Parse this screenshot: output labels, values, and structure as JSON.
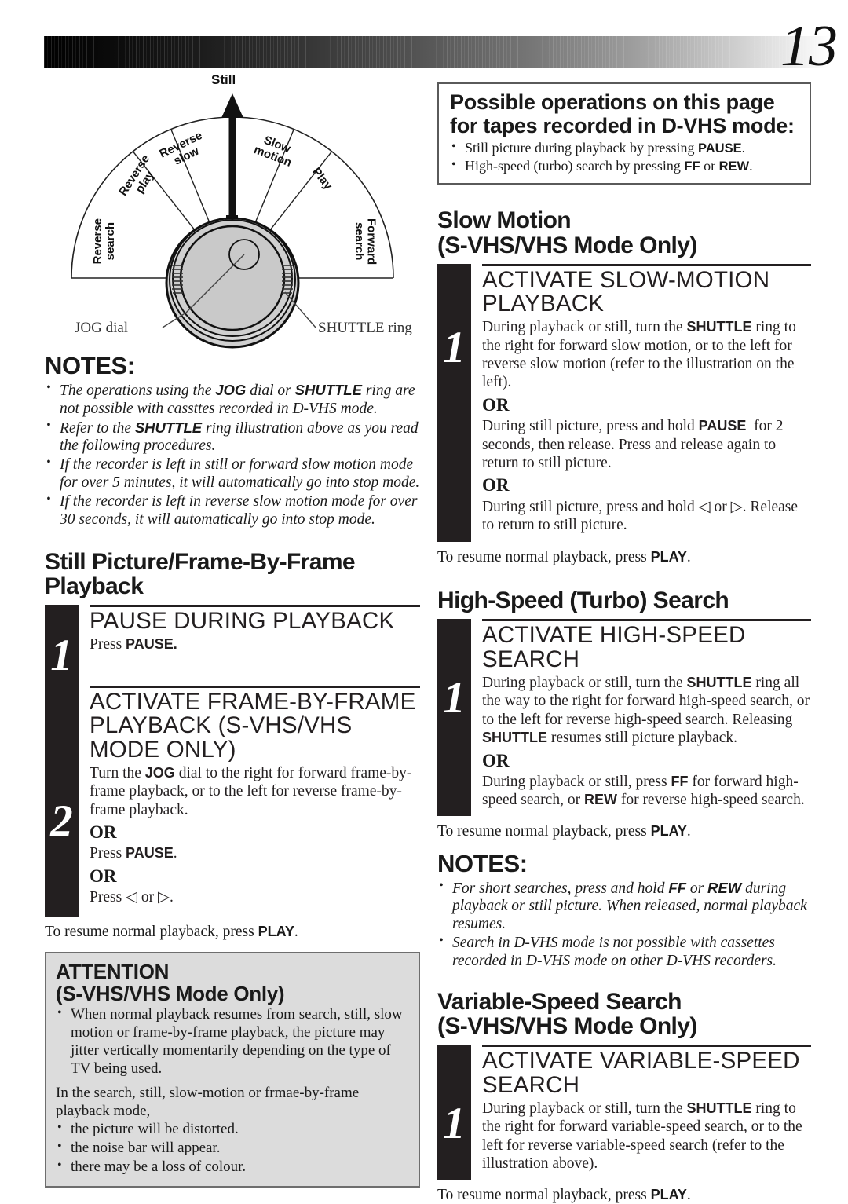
{
  "page": {
    "number": "13"
  },
  "diagram": {
    "title": "Still",
    "sectors": [
      "Reverse search",
      "Reverse play",
      "Reverse slow",
      "Slow motion",
      "Play",
      "Forward search"
    ],
    "callouts": {
      "jog": "JOG dial",
      "shuttle": "SHUTTLE ring"
    }
  },
  "notes_left": {
    "heading": "NOTES:",
    "items": [
      "The operations using the JOG dial or SHUTTLE ring are not possible with cassttes recorded in D-VHS mode.",
      "Refer to the SHUTTLE ring illustration above as you read the following procedures.",
      "If the recorder is left in still or forward slow motion mode for over 5 minutes, it will automatically go into stop mode.",
      "If the recorder is left in reverse slow motion mode for over 30 seconds, it will automatically go into stop mode."
    ]
  },
  "still_picture": {
    "heading": "Still Picture/Frame-By-Frame Playback",
    "step1": {
      "num": "1",
      "title": "PAUSE DURING PLAYBACK",
      "body": "Press PAUSE."
    },
    "step2": {
      "num": "2",
      "title": "ACTIVATE FRAME-BY-FRAME PLAYBACK (S-VHS/VHS MODE ONLY)",
      "body": "Turn the JOG dial to the right for forward frame-by-frame playback, or to the left for reverse frame-by-frame playback.",
      "or1_label": "OR",
      "or1_body": "Press PAUSE.",
      "or2_label": "OR",
      "or2_body": "Press ◁ or ▷."
    },
    "resume": "To resume normal playback, press PLAY."
  },
  "attention": {
    "heading_line1": "ATTENTION",
    "heading_line2": "(S-VHS/VHS Mode Only)",
    "bullet1": "When normal playback resumes from search, still, slow motion or frame-by-frame playback, the picture may jitter vertically momentarily depending on the type of TV being used.",
    "intro": "In the search, still, slow-motion or frmae-by-frame playback mode,",
    "items": [
      "the picture will be distorted.",
      "the noise bar will appear.",
      "there may be a loss of colour."
    ]
  },
  "possible_ops": {
    "heading": "Possible operations on this page for tapes recorded in D-VHS mode:",
    "items": [
      "Still picture during playback by pressing PAUSE.",
      "High-speed (turbo) search by pressing FF or REW."
    ]
  },
  "slow_motion": {
    "heading_line1": "Slow Motion",
    "heading_line2": "(S-VHS/VHS Mode Only)",
    "step1": {
      "num": "1",
      "title": "ACTIVATE SLOW-MOTION PLAYBACK",
      "body": "During playback or still, turn the SHUTTLE ring to the right for forward slow motion, or to the left for reverse slow motion (refer to the illustration on the left).",
      "or1_label": "OR",
      "or1_body": "During still picture, press and hold PAUSE  for 2 seconds, then release. Press and release again to return to still picture.",
      "or2_label": "OR",
      "or2_body": "During still picture, press and hold ◁ or ▷. Release to return to still picture."
    },
    "resume": "To resume normal playback, press PLAY."
  },
  "high_speed": {
    "heading": "High-Speed (Turbo) Search",
    "step1": {
      "num": "1",
      "title": "ACTIVATE HIGH-SPEED SEARCH",
      "body": "During playback or still, turn the SHUTTLE ring all the way to the right for forward high-speed search, or to the left for reverse high-speed search. Releasing SHUTTLE resumes still picture playback.",
      "or1_label": "OR",
      "or1_body": "During playback or still, press FF for forward high-speed search, or REW for reverse high-speed search."
    },
    "resume": "To resume normal playback, press PLAY.",
    "notes": {
      "heading": "NOTES:",
      "items": [
        "For short searches, press and hold FF or REW during playback or still picture. When released, normal playback resumes.",
        "Search in D-VHS mode is not possible with cassettes recorded in D-VHS mode on other D-VHS recorders."
      ]
    }
  },
  "variable_speed": {
    "heading_line1": "Variable-Speed Search",
    "heading_line2": "(S-VHS/VHS Mode Only)",
    "step1": {
      "num": "1",
      "title": "ACTIVATE VARIABLE-SPEED SEARCH",
      "body": "During playback or still, turn the SHUTTLE ring to the right for forward variable-speed search, or to the left for reverse variable-speed search (refer to the illustration above)."
    },
    "resume": "To resume normal playback, press PLAY."
  }
}
